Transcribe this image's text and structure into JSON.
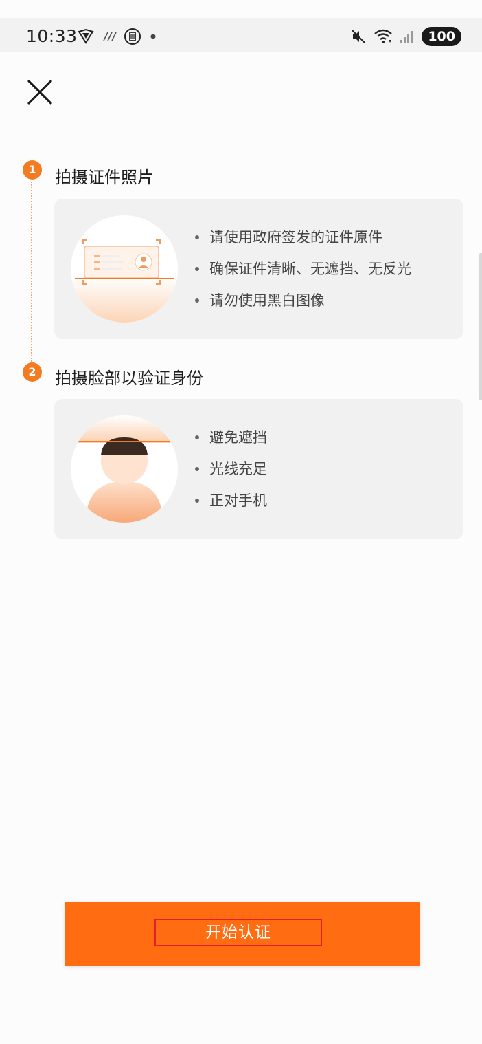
{
  "status_bar": {
    "time": "10:33",
    "battery": "100",
    "icons": [
      "vpn-shield-icon",
      "nfc-icon",
      "sim-icon",
      "dot-icon",
      "mute-icon",
      "wifi-icon",
      "signal-icon",
      "battery-icon"
    ]
  },
  "close": {
    "icon": "close-icon"
  },
  "steps": [
    {
      "number": "1",
      "title": "拍摄证件照片",
      "illustration": "id-card-scan-illustration",
      "tips": [
        "请使用政府签发的证件原件",
        "确保证件清晰、无遮挡、无反光",
        "请勿使用黑白图像"
      ]
    },
    {
      "number": "2",
      "title": "拍摄脸部以验证身份",
      "illustration": "face-scan-illustration",
      "tips": [
        "避免遮挡",
        "光线充足",
        "正对手机"
      ]
    }
  ],
  "start_button": {
    "label": "开始认证"
  },
  "colors": {
    "accent": "#ff6c12",
    "step_badge": "#f37b22",
    "card_bg": "#f1f1f1",
    "highlight_border": "#e2202b"
  }
}
